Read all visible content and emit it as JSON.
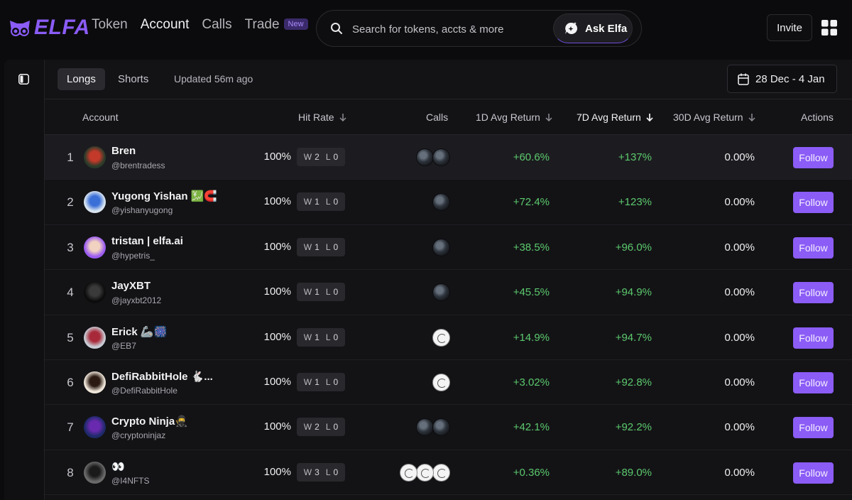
{
  "brand": {
    "name": "ELFA",
    "accent": "#8b5cf6"
  },
  "nav": [
    {
      "label": "Token",
      "active": false
    },
    {
      "label": "Account",
      "active": true
    },
    {
      "label": "Calls",
      "active": false
    },
    {
      "label": "Trade",
      "active": false,
      "badge": "New"
    }
  ],
  "search": {
    "placeholder": "Search for tokens, accts & more",
    "value": ""
  },
  "ask": {
    "label": "Ask Elfa"
  },
  "invite": {
    "label": "Invite"
  },
  "tabs": [
    {
      "label": "Longs",
      "active": true
    },
    {
      "label": "Shorts",
      "active": false
    }
  ],
  "updated": "Updated 56m ago",
  "date_range": "28 Dec - 4 Jan",
  "columns": {
    "account": "Account",
    "hit_rate": "Hit Rate",
    "calls": "Calls",
    "ret_1d": "1D Avg Return",
    "ret_7d": "7D Avg Return",
    "ret_30d": "30D Avg Return",
    "actions": "Actions"
  },
  "rows": [
    {
      "rank": "1",
      "name": "Bren",
      "handle": "@brentradess",
      "hit_rate": "100%",
      "w": "2",
      "l": "0",
      "coins": [
        "dark",
        "dark"
      ],
      "ret_1d": "+60.6%",
      "ret_7d": "+137%",
      "ret_30d": "0.00%",
      "action": "Follow",
      "avatar": [
        "#2a3b2a",
        "#c43a2a"
      ]
    },
    {
      "rank": "2",
      "name": "Yugong Yishan 💹🧲",
      "handle": "@yishanyugong",
      "hit_rate": "100%",
      "w": "1",
      "l": "0",
      "coins": [
        "dark"
      ],
      "ret_1d": "+72.4%",
      "ret_7d": "+123%",
      "ret_30d": "0.00%",
      "action": "Follow",
      "avatar": [
        "#d8e4f0",
        "#3a6fd8"
      ]
    },
    {
      "rank": "3",
      "name": "tristan | elfa.ai",
      "handle": "@hypetris_",
      "hit_rate": "100%",
      "w": "1",
      "l": "0",
      "coins": [
        "dark"
      ],
      "ret_1d": "+38.5%",
      "ret_7d": "+96.0%",
      "ret_30d": "0.00%",
      "action": "Follow",
      "avatar": [
        "#9b5cf0",
        "#f2d2c0"
      ]
    },
    {
      "rank": "4",
      "name": "JayXBT",
      "handle": "@jayxbt2012",
      "hit_rate": "100%",
      "w": "1",
      "l": "0",
      "coins": [
        "dark"
      ],
      "ret_1d": "+45.5%",
      "ret_7d": "+94.9%",
      "ret_30d": "0.00%",
      "action": "Follow",
      "avatar": [
        "#0c0c0c",
        "#3a3a3a"
      ]
    },
    {
      "rank": "5",
      "name": "Erick 🦾🎆",
      "handle": "@EB7",
      "hit_rate": "100%",
      "w": "1",
      "l": "0",
      "coins": [
        "white"
      ],
      "ret_1d": "+14.9%",
      "ret_7d": "+94.7%",
      "ret_30d": "0.00%",
      "action": "Follow",
      "avatar": [
        "#c8ccd4",
        "#a82a3a"
      ]
    },
    {
      "rank": "6",
      "name": "DefiRabbitHole 🐇...",
      "handle": "@DefiRabbitHole",
      "hit_rate": "100%",
      "w": "1",
      "l": "0",
      "coins": [
        "white"
      ],
      "ret_1d": "+3.02%",
      "ret_7d": "+92.8%",
      "ret_30d": "0.00%",
      "action": "Follow",
      "avatar": [
        "#f0e6da",
        "#2a1a12"
      ]
    },
    {
      "rank": "7",
      "name": "Crypto Ninja🥷",
      "handle": "@cryptoninjaz",
      "hit_rate": "100%",
      "w": "2",
      "l": "0",
      "coins": [
        "dark",
        "dark"
      ],
      "ret_1d": "+42.1%",
      "ret_7d": "+92.2%",
      "ret_30d": "0.00%",
      "action": "Follow",
      "avatar": [
        "#1e2a6a",
        "#6a2ab0"
      ]
    },
    {
      "rank": "8",
      "name": "👀",
      "handle": "@I4NFTS",
      "hit_rate": "100%",
      "w": "3",
      "l": "0",
      "coins": [
        "white",
        "white",
        "white"
      ],
      "ret_1d": "+0.36%",
      "ret_7d": "+89.0%",
      "ret_30d": "0.00%",
      "action": "Follow",
      "avatar": [
        "#6a6a6a",
        "#1a1a1a"
      ]
    }
  ],
  "labels": {
    "w": "W",
    "l": "L"
  }
}
